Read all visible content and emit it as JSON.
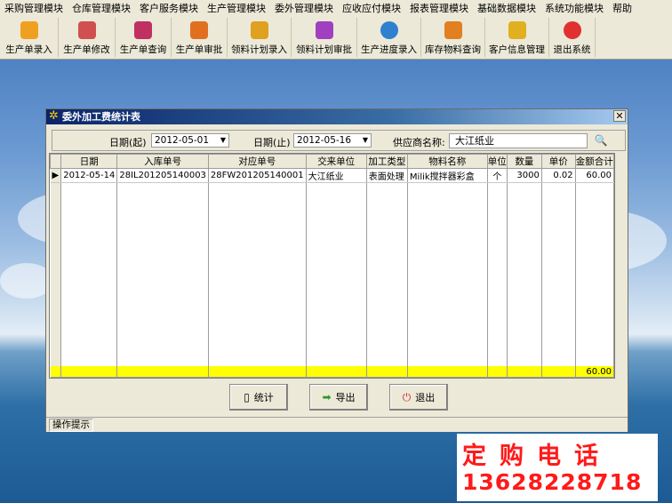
{
  "menubar": {
    "items": [
      "采购管理模块",
      "仓库管理模块",
      "客户服务模块",
      "生产管理模块",
      "委外管理模块",
      "应收应付模块",
      "报表管理模块",
      "基础数据模块",
      "系统功能模块",
      "帮助"
    ]
  },
  "toolbar": {
    "buttons": [
      {
        "label": "生产单录入",
        "icon": "box-icon",
        "color": "#f0a020"
      },
      {
        "label": "生产单修改",
        "icon": "books-icon",
        "color": "#d05050"
      },
      {
        "label": "生产单查询",
        "icon": "people-icon",
        "color": "#c03060"
      },
      {
        "label": "生产单审批",
        "icon": "hands-icon",
        "color": "#e07020"
      },
      {
        "label": "领料计划录入",
        "icon": "pen-icon",
        "color": "#e0a020"
      },
      {
        "label": "领料计划审批",
        "icon": "flower-icon",
        "color": "#a040c0"
      },
      {
        "label": "生产进度录入",
        "icon": "pie-icon",
        "color": "#3080d0"
      },
      {
        "label": "库存物料查询",
        "icon": "stack-icon",
        "color": "#e08020"
      },
      {
        "label": "客户信息管理",
        "icon": "crate-icon",
        "color": "#e0b020"
      },
      {
        "label": "退出系统",
        "icon": "power-icon",
        "color": "#e03030"
      }
    ]
  },
  "dialog": {
    "title": "委外加工费统计表",
    "filters": {
      "start_label": "日期(起)",
      "start_value": "2012-05-01",
      "end_label": "日期(止)",
      "end_value": "2012-05-16",
      "supplier_label": "供应商名称:",
      "supplier_value": "大江纸业"
    },
    "table": {
      "columns": [
        "日期",
        "入库单号",
        "对应单号",
        "交来单位",
        "加工类型",
        "物料名称",
        "单位",
        "数量",
        "单价",
        "金额合计"
      ],
      "rows": [
        [
          "2012-05-14",
          "28IL201205140003",
          "28FW201205140001",
          "大江纸业",
          "表面处理",
          "Milik搅拌器彩盒",
          "个",
          "3000",
          "0.02",
          "60.00"
        ]
      ],
      "total": "60.00"
    },
    "buttons": {
      "stats": "统计",
      "export": "导出",
      "exit": "退出"
    },
    "status": "操作提示"
  },
  "ad": {
    "title": "定购电话",
    "phone": "13628228718"
  }
}
